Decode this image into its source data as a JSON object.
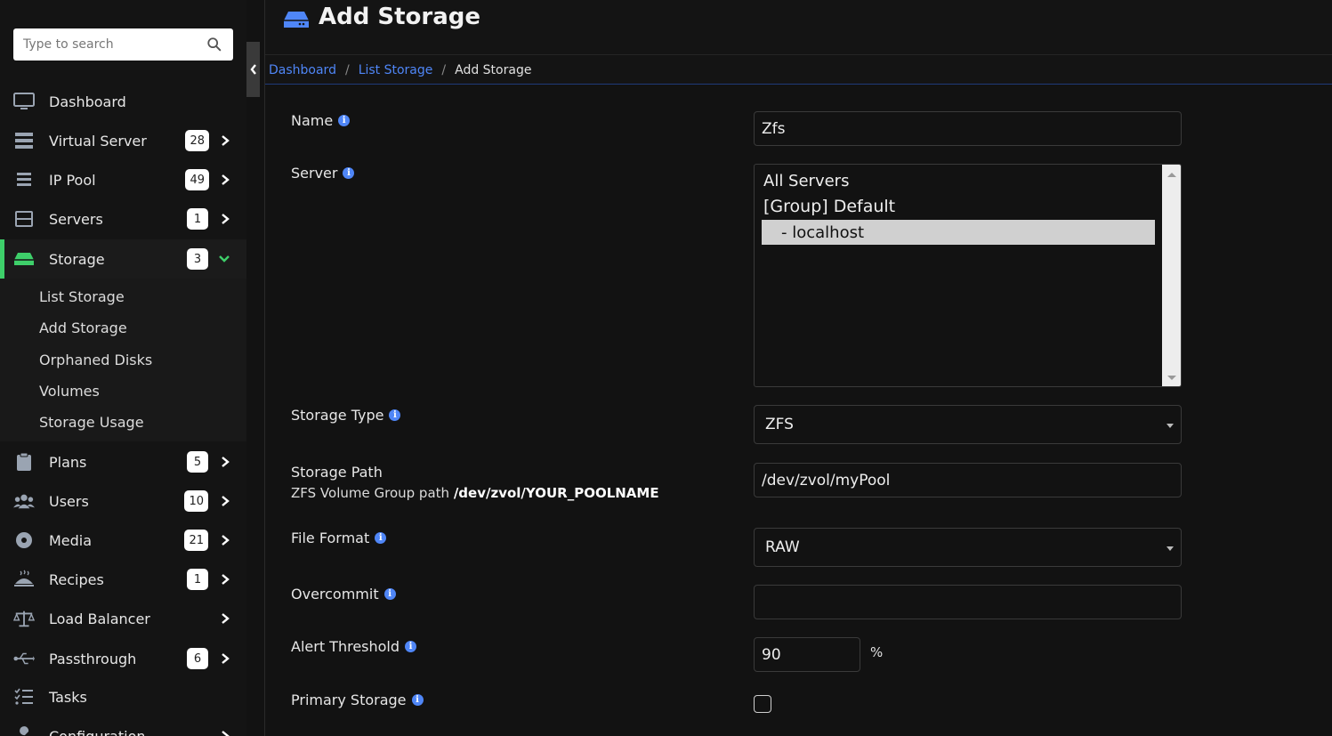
{
  "search": {
    "placeholder": "Type to search"
  },
  "sidebar": {
    "items": [
      {
        "label": "Dashboard",
        "badge": null,
        "icon": "monitor-icon"
      },
      {
        "label": "Virtual Server",
        "badge": "28",
        "icon": "server-stack-icon"
      },
      {
        "label": "IP Pool",
        "badge": "49",
        "icon": "list-icon"
      },
      {
        "label": "Servers",
        "badge": "1",
        "icon": "server-icon"
      },
      {
        "label": "Storage",
        "badge": "3",
        "icon": "hdd-icon",
        "active": true
      },
      {
        "label": "Plans",
        "badge": "5",
        "icon": "clipboard-icon"
      },
      {
        "label": "Users",
        "badge": "10",
        "icon": "users-icon"
      },
      {
        "label": "Media",
        "badge": "21",
        "icon": "disc-icon"
      },
      {
        "label": "Recipes",
        "badge": "1",
        "icon": "dish-icon"
      },
      {
        "label": "Load Balancer",
        "badge": null,
        "icon": "balance-scale-icon"
      },
      {
        "label": "Passthrough",
        "badge": "6",
        "icon": "usb-icon"
      },
      {
        "label": "Tasks",
        "badge": null,
        "icon": "tasks-icon"
      },
      {
        "label": "Configuration",
        "badge": null,
        "icon": "wrench-icon"
      }
    ],
    "storage_submenu": [
      "List Storage",
      "Add Storage",
      "Orphaned Disks",
      "Volumes",
      "Storage Usage"
    ]
  },
  "page": {
    "title": "Add Storage",
    "breadcrumb": [
      "Dashboard",
      "List Storage",
      "Add Storage"
    ]
  },
  "form": {
    "name_label": "Name",
    "name_value": "Zfs",
    "server_label": "Server",
    "server_options": [
      "All Servers",
      "[Group] Default",
      "- localhost"
    ],
    "server_selected": "- localhost",
    "storage_type_label": "Storage Type",
    "storage_type_value": "ZFS",
    "storage_path_label": "Storage Path",
    "storage_path_hint_prefix": "ZFS Volume Group path",
    "storage_path_hint_example": "/dev/zvol/YOUR_POOLNAME",
    "storage_path_value": "/dev/zvol/myPool",
    "file_format_label": "File Format",
    "file_format_value": "RAW",
    "overcommit_label": "Overcommit",
    "overcommit_value": "",
    "alert_threshold_label": "Alert Threshold",
    "alert_threshold_value": "90",
    "alert_threshold_unit": "%",
    "primary_storage_label": "Primary Storage",
    "primary_storage_checked": false
  },
  "colors": {
    "accent": "#4f86f7",
    "active": "#3ecf6a",
    "background": "#121212"
  }
}
